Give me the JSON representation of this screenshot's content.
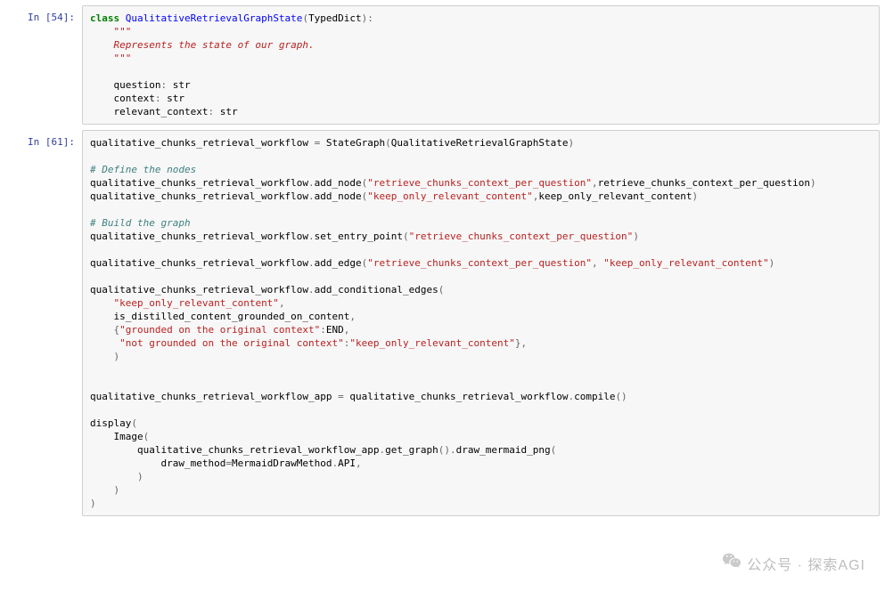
{
  "cells": [
    {
      "prompt": "In [54]:",
      "type": "code",
      "tokens": [
        [
          [
            "kw-green",
            "class"
          ],
          [
            "name",
            " "
          ],
          [
            "cls",
            "QualitativeRetrievalGraphState"
          ],
          [
            "op",
            "("
          ],
          [
            "name",
            "TypedDict"
          ],
          [
            "op",
            "):"
          ]
        ],
        [
          [
            "name",
            "    "
          ],
          [
            "docstr",
            "\"\"\""
          ]
        ],
        [
          [
            "docstr",
            "    Represents the state of our graph."
          ]
        ],
        [
          [
            "docstr",
            "    \"\"\""
          ]
        ],
        [
          [
            "name",
            ""
          ]
        ],
        [
          [
            "name",
            "    question"
          ],
          [
            "op",
            ":"
          ],
          [
            "name",
            " str"
          ]
        ],
        [
          [
            "name",
            "    context"
          ],
          [
            "op",
            ":"
          ],
          [
            "name",
            " str"
          ]
        ],
        [
          [
            "name",
            "    relevant_context"
          ],
          [
            "op",
            ":"
          ],
          [
            "name",
            " str"
          ]
        ]
      ]
    },
    {
      "prompt": "In [61]:",
      "type": "code",
      "tokens": [
        [
          [
            "name",
            "qualitative_chunks_retrieval_workflow "
          ],
          [
            "op",
            "="
          ],
          [
            "name",
            " StateGraph"
          ],
          [
            "op",
            "("
          ],
          [
            "name",
            "QualitativeRetrievalGraphState"
          ],
          [
            "op",
            ")"
          ]
        ],
        [
          [
            "name",
            ""
          ]
        ],
        [
          [
            "com",
            "# Define the nodes"
          ]
        ],
        [
          [
            "name",
            "qualitative_chunks_retrieval_workflow"
          ],
          [
            "op",
            "."
          ],
          [
            "name",
            "add_node"
          ],
          [
            "op",
            "("
          ],
          [
            "str",
            "\"retrieve_chunks_context_per_question\""
          ],
          [
            "op",
            ","
          ],
          [
            "name",
            "retrieve_chunks_context_per_question"
          ],
          [
            "op",
            ")"
          ]
        ],
        [
          [
            "name",
            "qualitative_chunks_retrieval_workflow"
          ],
          [
            "op",
            "."
          ],
          [
            "name",
            "add_node"
          ],
          [
            "op",
            "("
          ],
          [
            "str",
            "\"keep_only_relevant_content\""
          ],
          [
            "op",
            ","
          ],
          [
            "name",
            "keep_only_relevant_content"
          ],
          [
            "op",
            ")"
          ]
        ],
        [
          [
            "name",
            ""
          ]
        ],
        [
          [
            "com",
            "# Build the graph"
          ]
        ],
        [
          [
            "name",
            "qualitative_chunks_retrieval_workflow"
          ],
          [
            "op",
            "."
          ],
          [
            "name",
            "set_entry_point"
          ],
          [
            "op",
            "("
          ],
          [
            "str",
            "\"retrieve_chunks_context_per_question\""
          ],
          [
            "op",
            ")"
          ]
        ],
        [
          [
            "name",
            ""
          ]
        ],
        [
          [
            "name",
            "qualitative_chunks_retrieval_workflow"
          ],
          [
            "op",
            "."
          ],
          [
            "name",
            "add_edge"
          ],
          [
            "op",
            "("
          ],
          [
            "str",
            "\"retrieve_chunks_context_per_question\""
          ],
          [
            "op",
            ", "
          ],
          [
            "str",
            "\"keep_only_relevant_content\""
          ],
          [
            "op",
            ")"
          ]
        ],
        [
          [
            "name",
            ""
          ]
        ],
        [
          [
            "name",
            "qualitative_chunks_retrieval_workflow"
          ],
          [
            "op",
            "."
          ],
          [
            "name",
            "add_conditional_edges"
          ],
          [
            "op",
            "("
          ]
        ],
        [
          [
            "name",
            "    "
          ],
          [
            "str",
            "\"keep_only_relevant_content\""
          ],
          [
            "op",
            ","
          ]
        ],
        [
          [
            "name",
            "    is_distilled_content_grounded_on_content"
          ],
          [
            "op",
            ","
          ]
        ],
        [
          [
            "name",
            "    "
          ],
          [
            "op",
            "{"
          ],
          [
            "str",
            "\"grounded on the original context\""
          ],
          [
            "op",
            ":"
          ],
          [
            "name",
            "END"
          ],
          [
            "op",
            ","
          ]
        ],
        [
          [
            "name",
            "     "
          ],
          [
            "str",
            "\"not grounded on the original context\""
          ],
          [
            "op",
            ":"
          ],
          [
            "str",
            "\"keep_only_relevant_content\""
          ],
          [
            "op",
            "},"
          ]
        ],
        [
          [
            "name",
            "    "
          ],
          [
            "op",
            ")"
          ]
        ],
        [
          [
            "name",
            ""
          ]
        ],
        [
          [
            "name",
            ""
          ]
        ],
        [
          [
            "name",
            "qualitative_chunks_retrieval_workflow_app "
          ],
          [
            "op",
            "="
          ],
          [
            "name",
            " qualitative_chunks_retrieval_workflow"
          ],
          [
            "op",
            "."
          ],
          [
            "name",
            "compile"
          ],
          [
            "op",
            "()"
          ]
        ],
        [
          [
            "name",
            ""
          ]
        ],
        [
          [
            "name",
            "display"
          ],
          [
            "op",
            "("
          ]
        ],
        [
          [
            "name",
            "    Image"
          ],
          [
            "op",
            "("
          ]
        ],
        [
          [
            "name",
            "        qualitative_chunks_retrieval_workflow_app"
          ],
          [
            "op",
            "."
          ],
          [
            "name",
            "get_graph"
          ],
          [
            "op",
            "()."
          ],
          [
            "name",
            "draw_mermaid_png"
          ],
          [
            "op",
            "("
          ]
        ],
        [
          [
            "name",
            "            draw_method"
          ],
          [
            "op",
            "="
          ],
          [
            "name",
            "MermaidDrawMethod"
          ],
          [
            "op",
            "."
          ],
          [
            "name",
            "API"
          ],
          [
            "op",
            ","
          ]
        ],
        [
          [
            "name",
            "        "
          ],
          [
            "op",
            ")"
          ]
        ],
        [
          [
            "name",
            "    "
          ],
          [
            "op",
            ")"
          ]
        ],
        [
          [
            "op",
            ")"
          ]
        ]
      ]
    }
  ],
  "watermark": {
    "label": "公众号 · 探索AGI"
  }
}
